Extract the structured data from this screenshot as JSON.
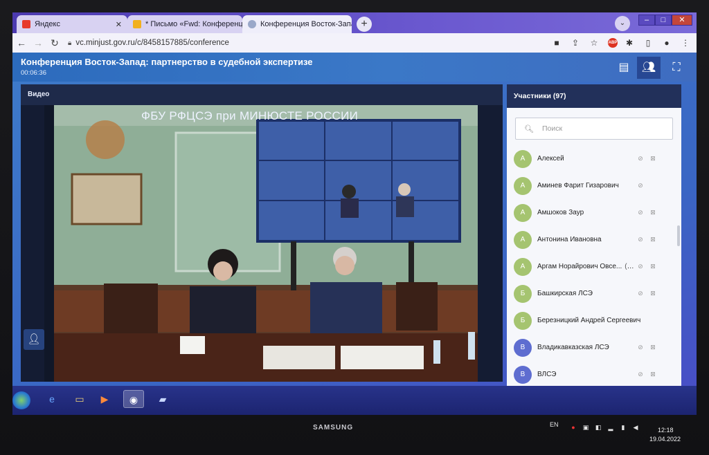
{
  "browser": {
    "tabs": [
      {
        "title": "Яндекс",
        "favicon": "yandex-icon",
        "color": "#e7392b"
      },
      {
        "title": "* Письмо «Fwd: Конференция В",
        "favicon": "mail-icon",
        "color": "#f2b01e"
      },
      {
        "title": "Конференция Восток-Запад",
        "favicon": "globe-icon",
        "color": "#9aa8c9"
      }
    ],
    "new_tab": "+",
    "url": "vc.minjust.gov.ru/c/8458157885/conference"
  },
  "app": {
    "title": "Конференция Восток-Запад: партнерство в судебной экспертизе",
    "timer": "00:06:36"
  },
  "video": {
    "panel_title": "Видео",
    "caption": "ФБУ РФЦСЭ при МИНЮСТЕ РОССИИ"
  },
  "participants": {
    "panel_title": "Участники (97)",
    "search_placeholder": "Поиск",
    "items": [
      {
        "initial": "А",
        "name": "Алексей",
        "you": ""
      },
      {
        "initial": "А",
        "name": "Аминев Фарит Гизарович",
        "you": ""
      },
      {
        "initial": "А",
        "name": "Амшоков Заур",
        "you": ""
      },
      {
        "initial": "А",
        "name": "Антонина Ивановна",
        "you": ""
      },
      {
        "initial": "А",
        "name": "Аргам Норайрович Овсе...",
        "you": "(вы)"
      },
      {
        "initial": "Б",
        "name": "Башкирская ЛСЭ",
        "you": ""
      },
      {
        "initial": "Б",
        "name": "Березницкий Андрей Сергеевич",
        "you": ""
      },
      {
        "initial": "В",
        "name": "Владикавказская ЛСЭ",
        "you": ""
      },
      {
        "initial": "В",
        "name": "ВЛСЭ",
        "you": ""
      }
    ]
  },
  "os": {
    "brand": "SAMSUNG",
    "lang": "EN",
    "time": "12:18",
    "date": "19.04.2022"
  }
}
